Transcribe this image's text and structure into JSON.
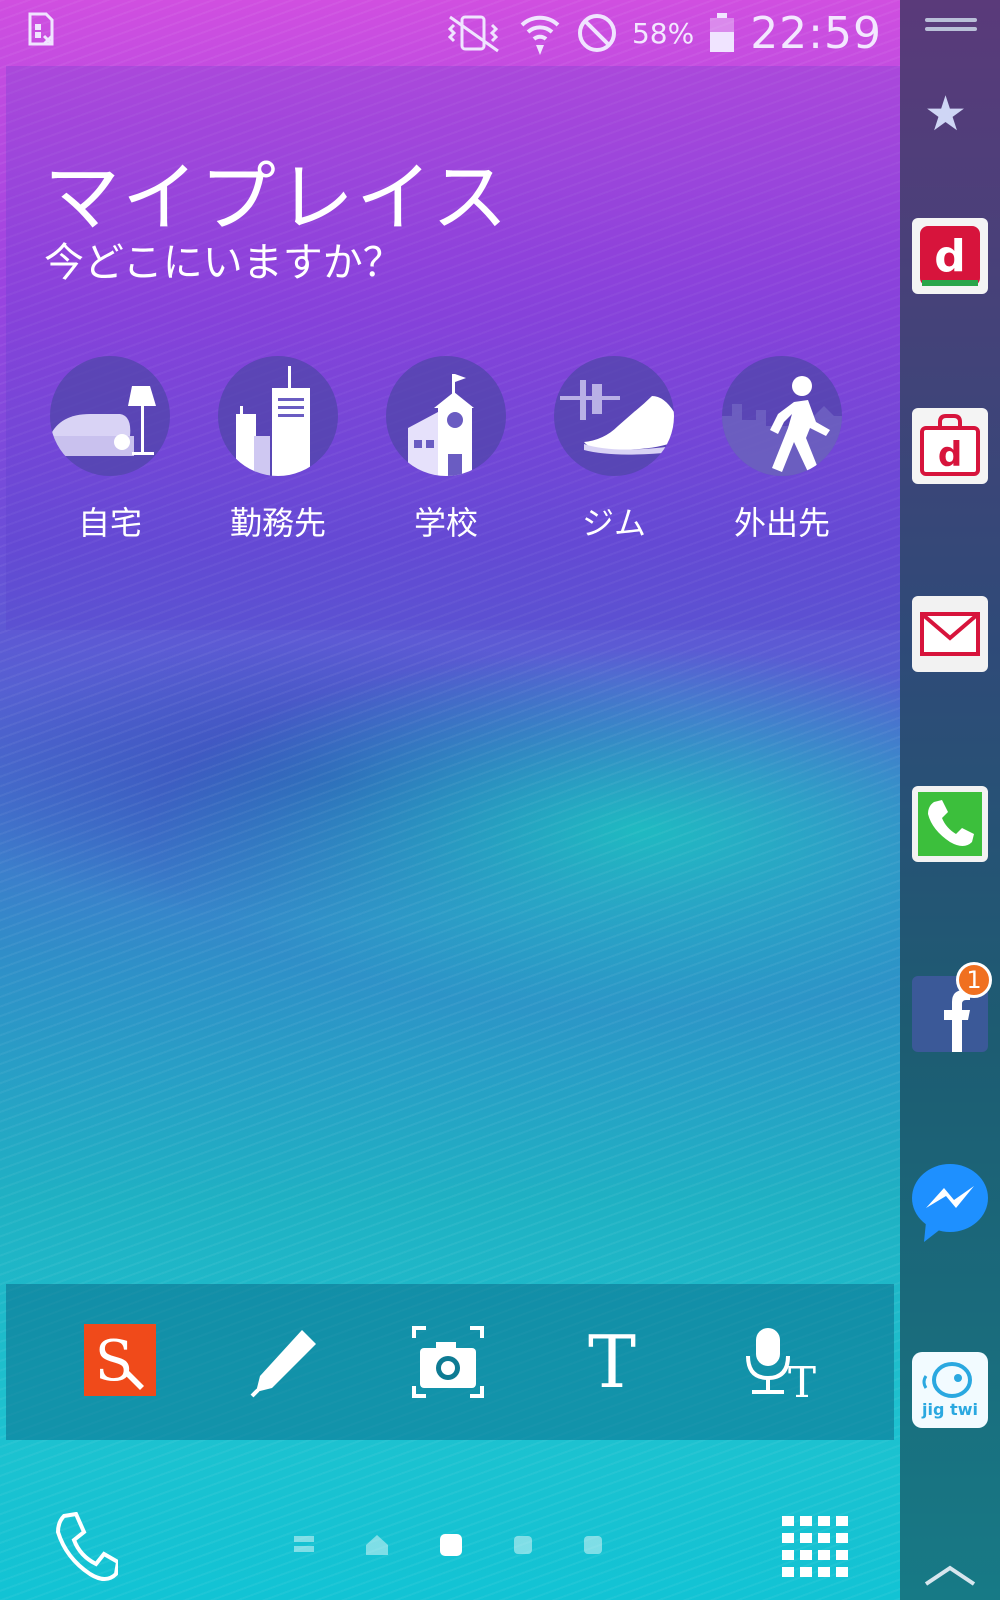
{
  "status_bar": {
    "battery_percent": "58%",
    "time": "22:59",
    "icons": [
      "sim-absent-icon",
      "vibrate-icon",
      "wifi-icon",
      "block-icon",
      "battery-icon"
    ]
  },
  "widget": {
    "title": "マイプレイス",
    "subtitle": "今どこにいますか？",
    "places": [
      {
        "label": "自宅",
        "icon": "home-sofa-icon"
      },
      {
        "label": "勤務先",
        "icon": "office-building-icon"
      },
      {
        "label": "学校",
        "icon": "school-icon"
      },
      {
        "label": "ジム",
        "icon": "sneaker-icon"
      },
      {
        "label": "外出先",
        "icon": "walking-person-icon"
      }
    ]
  },
  "edge_panel": {
    "apps": [
      {
        "name": "docomo-d-icon",
        "letter": "d"
      },
      {
        "name": "d-market-icon",
        "letter": "d"
      },
      {
        "name": "mail-icon"
      },
      {
        "name": "phone-app-icon"
      },
      {
        "name": "facebook-icon",
        "badge": "1"
      },
      {
        "name": "messenger-icon"
      },
      {
        "name": "jigtwi-icon",
        "label": "jig twi"
      }
    ],
    "colors": {
      "docomo_red": "#d7143c",
      "phone_green": "#3cbf3c",
      "facebook_blue": "#3b5998",
      "messenger_blue": "#1e90ff"
    }
  },
  "dock": {
    "items": [
      {
        "name": "s-note-icon",
        "letter": "S"
      },
      {
        "name": "pen-icon"
      },
      {
        "name": "camera-capture-icon"
      },
      {
        "name": "text-icon",
        "letter": "T"
      },
      {
        "name": "voice-text-icon",
        "letter": "T"
      }
    ]
  },
  "nav": {
    "page_count": 5,
    "active_page": 3
  }
}
